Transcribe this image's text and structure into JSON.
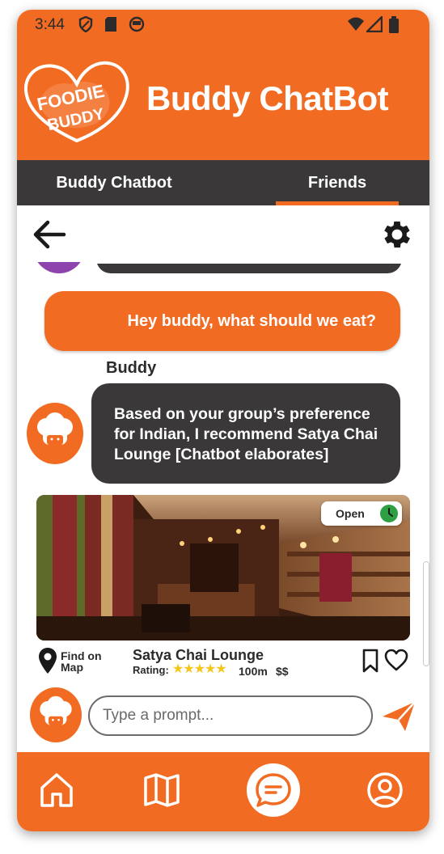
{
  "status_bar": {
    "time": "3:44"
  },
  "header": {
    "title": "Buddy ChatBot",
    "logo_text_line1": "FOODIE",
    "logo_text_line2": "BUDDY"
  },
  "tabs": [
    {
      "label": "Buddy Chatbot",
      "active": false
    },
    {
      "label": "Friends",
      "active": true
    }
  ],
  "chat": {
    "user_message": "Hey buddy, what should we eat?",
    "bot_name": "Buddy",
    "bot_message": "Based on your group’s preference for Indian, I recommend Satya Chai Lounge [Chatbot elaborates]"
  },
  "restaurant": {
    "status": "Open",
    "find_on_map": "Find on Map",
    "name": "Satya Chai Lounge",
    "rating_label": "Rating:",
    "rating": 5,
    "stars": "★★★★★",
    "distance": "100m",
    "price": "$$"
  },
  "input": {
    "placeholder": "Type a prompt..."
  },
  "colors": {
    "accent": "#f26b22",
    "dark": "#3a3838",
    "open_green": "#2ea043",
    "star": "#f5c518"
  },
  "icons": {
    "back": "arrow-left-icon",
    "settings": "gear-icon",
    "clock": "clock-icon",
    "pin": "map-pin-icon",
    "bookmark": "bookmark-icon",
    "heart": "heart-icon",
    "send": "paper-plane-icon",
    "home": "home-icon",
    "map": "map-icon",
    "chat": "chat-icon",
    "profile": "profile-icon"
  }
}
